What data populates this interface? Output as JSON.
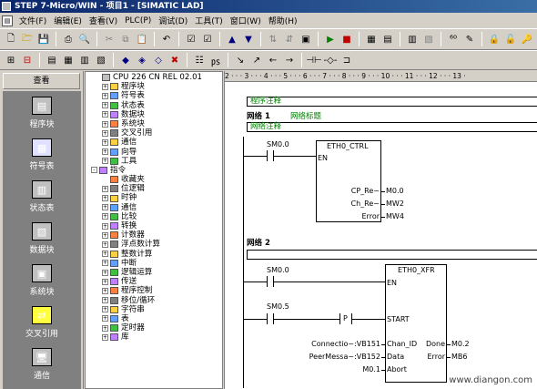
{
  "window": {
    "title": "STEP 7-Micro/WIN - 项目1 - [SIMATIC LAD]"
  },
  "menu": [
    "文件(F)",
    "编辑(E)",
    "查看(V)",
    "PLC(P)",
    "调试(D)",
    "工具(T)",
    "窗口(W)",
    "帮助(H)"
  ],
  "left_panel": {
    "header": "查看",
    "items": [
      "程序块",
      "符号表",
      "状态表",
      "数据块",
      "系统块",
      "交叉引用",
      "通信"
    ]
  },
  "tree": [
    {
      "label": "CPU 226 CN REL 02.01",
      "level": 0
    },
    {
      "label": "程序块",
      "level": 1,
      "pm": "+"
    },
    {
      "label": "符号表",
      "level": 1,
      "pm": "+"
    },
    {
      "label": "状态表",
      "level": 1,
      "pm": "+"
    },
    {
      "label": "数据块",
      "level": 1,
      "pm": "+"
    },
    {
      "label": "系统块",
      "level": 1,
      "pm": "+"
    },
    {
      "label": "交叉引用",
      "level": 1,
      "pm": "+"
    },
    {
      "label": "通信",
      "level": 1,
      "pm": "+"
    },
    {
      "label": "向导",
      "level": 1,
      "pm": "+"
    },
    {
      "label": "工具",
      "level": 1,
      "pm": "+"
    },
    {
      "label": "指令",
      "level": 0,
      "pm": "-"
    },
    {
      "label": "收藏夹",
      "level": 1
    },
    {
      "label": "位逻辑",
      "level": 1,
      "pm": "+"
    },
    {
      "label": "时钟",
      "level": 1,
      "pm": "+"
    },
    {
      "label": "通信",
      "level": 1,
      "pm": "+"
    },
    {
      "label": "比较",
      "level": 1,
      "pm": "+"
    },
    {
      "label": "转换",
      "level": 1,
      "pm": "+"
    },
    {
      "label": "计数器",
      "level": 1,
      "pm": "+"
    },
    {
      "label": "浮点数计算",
      "level": 1,
      "pm": "+"
    },
    {
      "label": "整数计算",
      "level": 1,
      "pm": "+"
    },
    {
      "label": "中断",
      "level": 1,
      "pm": "+"
    },
    {
      "label": "逻辑运算",
      "level": 1,
      "pm": "+"
    },
    {
      "label": "传送",
      "level": 1,
      "pm": "+"
    },
    {
      "label": "程序控制",
      "level": 1,
      "pm": "+"
    },
    {
      "label": "移位/循环",
      "level": 1,
      "pm": "+"
    },
    {
      "label": "字符串",
      "level": 1,
      "pm": "+"
    },
    {
      "label": "表",
      "level": 1,
      "pm": "+"
    },
    {
      "label": "定时器",
      "level": 1,
      "pm": "+"
    },
    {
      "label": "库",
      "level": 1,
      "pm": "+"
    }
  ],
  "ruler": "2 · · · 3 · · · 4 · · · 5 · · · 6 · · · 7 · · · 8 · · · 9 · · · 10 · · · 11 · · · 12 · · · 13 ·",
  "editor": {
    "program_comment": "程序注释",
    "network1": {
      "label": "网络 1",
      "title": "网络标题",
      "comment": "网络注释",
      "contact": "SM0.0",
      "block": "ETH0_CTRL",
      "en": "EN",
      "outputs": [
        {
          "pin": "CP_Re~",
          "addr": "M0.0"
        },
        {
          "pin": "Ch_Re~",
          "addr": "MW2"
        },
        {
          "pin": "Error",
          "addr": "MW4"
        }
      ]
    },
    "network2": {
      "label": "网络 2",
      "contact1": "SM0.0",
      "contact2": "SM0.5",
      "p_contact": "P",
      "block": "ETH0_XFR",
      "en": "EN",
      "start": "START",
      "inputs": [
        {
          "addr": "Connectio~:VB151",
          "pin": "Chan_ID"
        },
        {
          "addr": "PeerMessa~:VB152",
          "pin": "Data"
        },
        {
          "addr": "M0.1",
          "pin": "Abort"
        }
      ],
      "outputs": [
        {
          "pin": "Done",
          "addr": "M0.2"
        },
        {
          "pin": "Error",
          "addr": "MB6"
        }
      ]
    }
  },
  "watermark": "www.diangon.com"
}
